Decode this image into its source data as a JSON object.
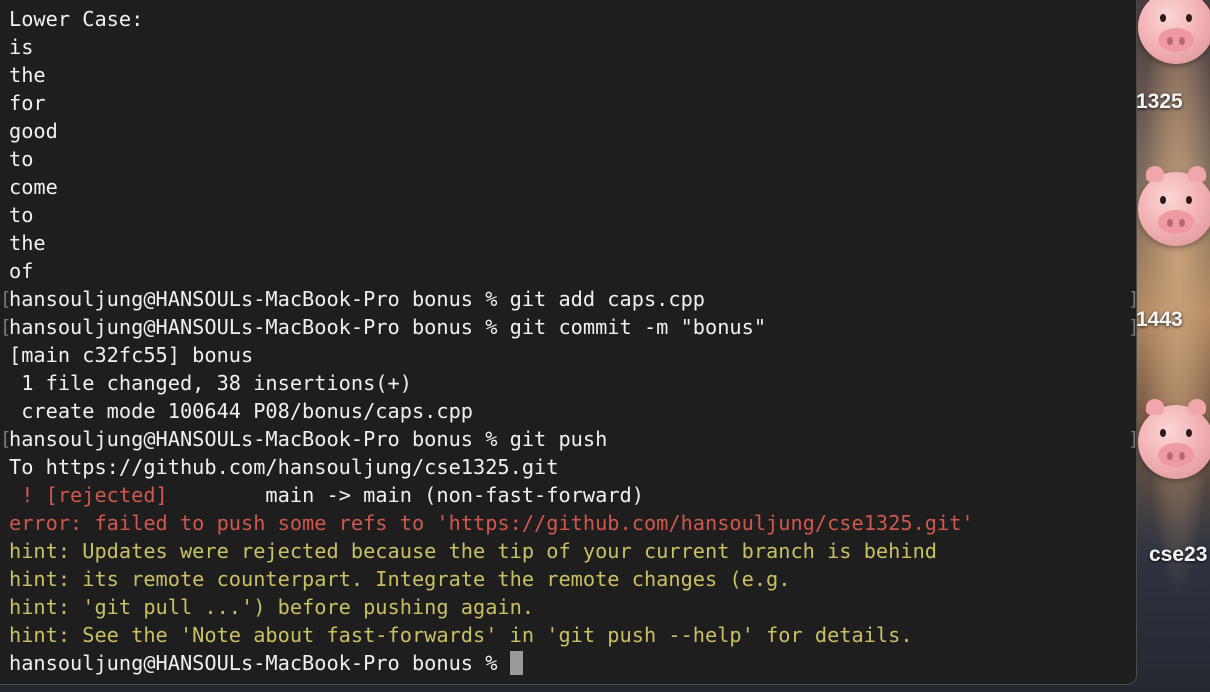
{
  "terminal": {
    "lines": [
      {
        "text": "Lower Case:",
        "style": "normal",
        "prompt_marks": false
      },
      {
        "text": "is",
        "style": "normal",
        "prompt_marks": false
      },
      {
        "text": "the",
        "style": "normal",
        "prompt_marks": false
      },
      {
        "text": "for",
        "style": "normal",
        "prompt_marks": false
      },
      {
        "text": "good",
        "style": "normal",
        "prompt_marks": false
      },
      {
        "text": "to",
        "style": "normal",
        "prompt_marks": false
      },
      {
        "text": "come",
        "style": "normal",
        "prompt_marks": false
      },
      {
        "text": "to",
        "style": "normal",
        "prompt_marks": false
      },
      {
        "text": "the",
        "style": "normal",
        "prompt_marks": false
      },
      {
        "text": "of",
        "style": "normal",
        "prompt_marks": false
      },
      {
        "text": "hansouljung@HANSOULs-MacBook-Pro bonus % git add caps.cpp",
        "style": "normal",
        "prompt_marks": true
      },
      {
        "text": "hansouljung@HANSOULs-MacBook-Pro bonus % git commit -m \"bonus\"",
        "style": "normal",
        "prompt_marks": true
      },
      {
        "text": "[main c32fc55] bonus",
        "style": "normal",
        "prompt_marks": false
      },
      {
        "text": " 1 file changed, 38 insertions(+)",
        "style": "normal",
        "prompt_marks": false
      },
      {
        "text": " create mode 100644 P08/bonus/caps.cpp",
        "style": "normal",
        "prompt_marks": false
      },
      {
        "text": "hansouljung@HANSOULs-MacBook-Pro bonus % git push",
        "style": "normal",
        "prompt_marks": true
      },
      {
        "text": "To https://github.com/hansouljung/cse1325.git",
        "style": "normal",
        "prompt_marks": false
      },
      {
        "text": " ! [rejected]        main -> main (non-fast-forward)",
        "style": "rejected",
        "prompt_marks": false
      },
      {
        "text": "error: failed to push some refs to 'https://github.com/hansouljung/cse1325.git'",
        "style": "red",
        "prompt_marks": false
      },
      {
        "text": "hint: Updates were rejected because the tip of your current branch is behind",
        "style": "yellow",
        "prompt_marks": false
      },
      {
        "text": "hint: its remote counterpart. Integrate the remote changes (e.g.",
        "style": "yellow",
        "prompt_marks": false
      },
      {
        "text": "hint: 'git pull ...') before pushing again.",
        "style": "yellow",
        "prompt_marks": false
      },
      {
        "text": "hint: See the 'Note about fast-forwards' in 'git push --help' for details.",
        "style": "yellow",
        "prompt_marks": false
      }
    ],
    "current_prompt": "hansouljung@HANSOULs-MacBook-Pro bonus % ",
    "rejected_parts": {
      "marker": " ! [rejected]",
      "rest": "        main -> main (non-fast-forward)"
    },
    "mark_left": "[",
    "mark_right": "]",
    "colors": {
      "background": "#1e1e1e",
      "text": "#f0f0f0",
      "error": "#d0574c",
      "hint": "#c8c063",
      "cursor": "#9a9a9a"
    }
  },
  "desktop": {
    "labels": [
      "1325",
      "1443",
      "cse23"
    ],
    "icons": [
      "pig-folder-icon",
      "pig-folder-icon",
      "pig-folder-icon"
    ]
  }
}
